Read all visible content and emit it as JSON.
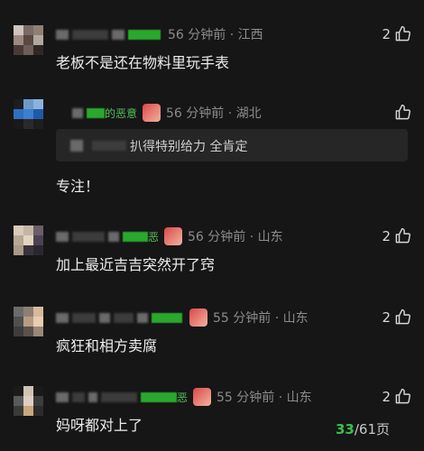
{
  "comments": [
    {
      "meta": "56 分钟前 · 江西",
      "likes": "2",
      "text": "老板不是还在物料里玩手表"
    },
    {
      "name_visible": "的恶意",
      "meta": "56 分钟前 · 湖北",
      "likes": "",
      "reply_quote": "扒得特别给力 全肯定",
      "text": "专注！"
    },
    {
      "name_visible": "恶",
      "meta": "56 分钟前 · 山东",
      "likes": "2",
      "text": "加上最近吉吉突然开了窍"
    },
    {
      "meta": "55 分钟前 · 山东",
      "likes": "2",
      "text": "疯狂和相方卖腐"
    },
    {
      "name_visible": "恶",
      "meta": "55 分钟前 · 山东",
      "likes": "2",
      "text": "妈呀都对上了"
    }
  ],
  "pagination": {
    "current": "33",
    "total": "/61页"
  },
  "colors": {
    "background": "#161616",
    "accent_green": "#36c24a",
    "meta_gray": "#8c8c8c"
  },
  "icons": {
    "like": "thumbs-up-outline-icon",
    "emoji": "sticker-emoji-icon"
  }
}
